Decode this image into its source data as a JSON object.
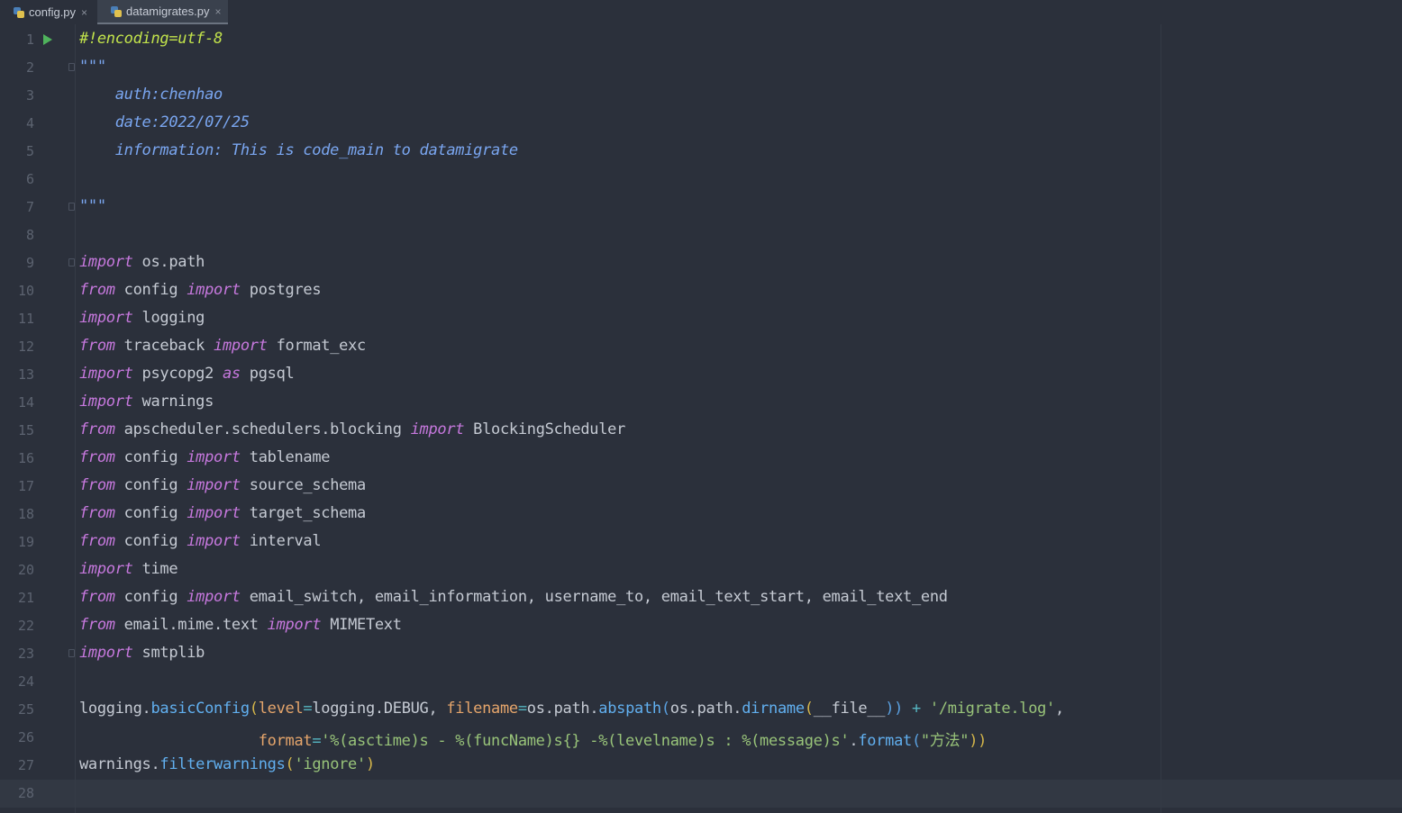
{
  "tabs": [
    {
      "label": "config.py",
      "close": "×",
      "active": false,
      "icon": "python-file-icon"
    },
    {
      "label": "datamigrates.py",
      "close": "×",
      "active": true,
      "icon": "python-file-icon"
    }
  ],
  "editor": {
    "current_line": 28,
    "lines": [
      {
        "n": "1",
        "segs": [
          [
            "#!encoding=utf-8",
            "cm"
          ]
        ]
      },
      {
        "n": "2",
        "segs": [
          [
            "\"\"\"",
            "ds"
          ]
        ]
      },
      {
        "n": "3",
        "segs": [
          [
            "    auth:chenhao",
            "ds"
          ]
        ]
      },
      {
        "n": "4",
        "segs": [
          [
            "    date:2022/07/25",
            "ds"
          ]
        ]
      },
      {
        "n": "5",
        "segs": [
          [
            "    information: This is code_main to datamigrate",
            "ds"
          ]
        ]
      },
      {
        "n": "6",
        "segs": []
      },
      {
        "n": "7",
        "segs": [
          [
            "\"\"\"",
            "ds"
          ]
        ]
      },
      {
        "n": "8",
        "segs": []
      },
      {
        "n": "9",
        "segs": [
          [
            "import",
            "kw"
          ],
          [
            " os.path",
            ""
          ]
        ]
      },
      {
        "n": "10",
        "segs": [
          [
            "from",
            "kw"
          ],
          [
            " config ",
            ""
          ],
          [
            "import",
            "kw"
          ],
          [
            " postgres",
            ""
          ]
        ]
      },
      {
        "n": "11",
        "segs": [
          [
            "import",
            "kw"
          ],
          [
            " logging",
            ""
          ]
        ]
      },
      {
        "n": "12",
        "segs": [
          [
            "from",
            "kw"
          ],
          [
            " traceback ",
            ""
          ],
          [
            "import",
            "kw"
          ],
          [
            " format_exc",
            ""
          ]
        ]
      },
      {
        "n": "13",
        "segs": [
          [
            "import",
            "kw"
          ],
          [
            " psycopg2 ",
            ""
          ],
          [
            "as",
            "kw"
          ],
          [
            " pgsql",
            ""
          ]
        ]
      },
      {
        "n": "14",
        "segs": [
          [
            "import",
            "kw"
          ],
          [
            " warnings",
            ""
          ]
        ]
      },
      {
        "n": "15",
        "segs": [
          [
            "from",
            "kw"
          ],
          [
            " apscheduler.schedulers.blocking ",
            ""
          ],
          [
            "import",
            "kw"
          ],
          [
            " BlockingScheduler",
            ""
          ]
        ]
      },
      {
        "n": "16",
        "segs": [
          [
            "from",
            "kw"
          ],
          [
            " config ",
            ""
          ],
          [
            "import",
            "kw"
          ],
          [
            " tablename",
            ""
          ]
        ]
      },
      {
        "n": "17",
        "segs": [
          [
            "from",
            "kw"
          ],
          [
            " config ",
            ""
          ],
          [
            "import",
            "kw"
          ],
          [
            " source_schema",
            ""
          ]
        ]
      },
      {
        "n": "18",
        "segs": [
          [
            "from",
            "kw"
          ],
          [
            " config ",
            ""
          ],
          [
            "import",
            "kw"
          ],
          [
            " target_schema",
            ""
          ]
        ]
      },
      {
        "n": "19",
        "segs": [
          [
            "from",
            "kw"
          ],
          [
            " config ",
            ""
          ],
          [
            "import",
            "kw"
          ],
          [
            " interval",
            ""
          ]
        ]
      },
      {
        "n": "20",
        "segs": [
          [
            "import",
            "kw"
          ],
          [
            " time",
            ""
          ]
        ]
      },
      {
        "n": "21",
        "segs": [
          [
            "from",
            "kw"
          ],
          [
            " config ",
            ""
          ],
          [
            "import",
            "kw"
          ],
          [
            " email_switch, email_information, username_to, email_text_start, email_text_end",
            ""
          ]
        ]
      },
      {
        "n": "22",
        "segs": [
          [
            "from",
            "kw"
          ],
          [
            " email.mime.text ",
            ""
          ],
          [
            "import",
            "kw"
          ],
          [
            " MIMEText",
            ""
          ]
        ]
      },
      {
        "n": "23",
        "segs": [
          [
            "import",
            "kw"
          ],
          [
            " smtplib",
            ""
          ]
        ]
      },
      {
        "n": "24",
        "segs": []
      },
      {
        "n": "25",
        "segs": [
          [
            "logging.",
            ""
          ],
          [
            "basicConfig",
            "fn"
          ],
          [
            "(",
            "br"
          ],
          [
            "level",
            "pa"
          ],
          [
            "=",
            "op"
          ],
          [
            "logging.DEBUG, ",
            ""
          ],
          [
            "filename",
            "pa"
          ],
          [
            "=",
            "op"
          ],
          [
            "os.path.",
            ""
          ],
          [
            "abspath",
            "fn"
          ],
          [
            "(",
            "br2"
          ],
          [
            "os.path.",
            ""
          ],
          [
            "dirname",
            "fn"
          ],
          [
            "(",
            "br"
          ],
          [
            "__file__",
            ""
          ],
          [
            "))",
            "br2"
          ],
          [
            " + ",
            "op"
          ],
          [
            "'/migrate.log'",
            "st"
          ],
          [
            ",",
            ""
          ]
        ]
      },
      {
        "n": "26",
        "segs": [
          [
            "                    ",
            ""
          ],
          [
            "format",
            "pa"
          ],
          [
            "=",
            "op"
          ],
          [
            "'%(asctime)s - %(funcName)s{} -%(levelname)s : %(message)s'",
            "st"
          ],
          [
            ".",
            ""
          ],
          [
            "format",
            "fn"
          ],
          [
            "(",
            "br2"
          ],
          [
            "\"方法\"",
            "st"
          ],
          [
            "))",
            "br"
          ]
        ]
      },
      {
        "n": "27",
        "segs": [
          [
            "warnings.",
            ""
          ],
          [
            "filterwarnings",
            "fn"
          ],
          [
            "(",
            "br"
          ],
          [
            "'ignore'",
            "st"
          ],
          [
            ")",
            "br"
          ]
        ]
      },
      {
        "n": "28",
        "segs": []
      }
    ]
  },
  "gutter_markers": {
    "run_line": 1,
    "fold_lines": [
      2,
      7,
      9,
      23
    ]
  },
  "colors": {
    "background": "#2b303b",
    "keyword": "#c678dd",
    "comment": "#c2e34b",
    "docstring": "#7aa6f0",
    "function": "#61afef",
    "parameter": "#e5a56b",
    "string": "#98c379"
  }
}
